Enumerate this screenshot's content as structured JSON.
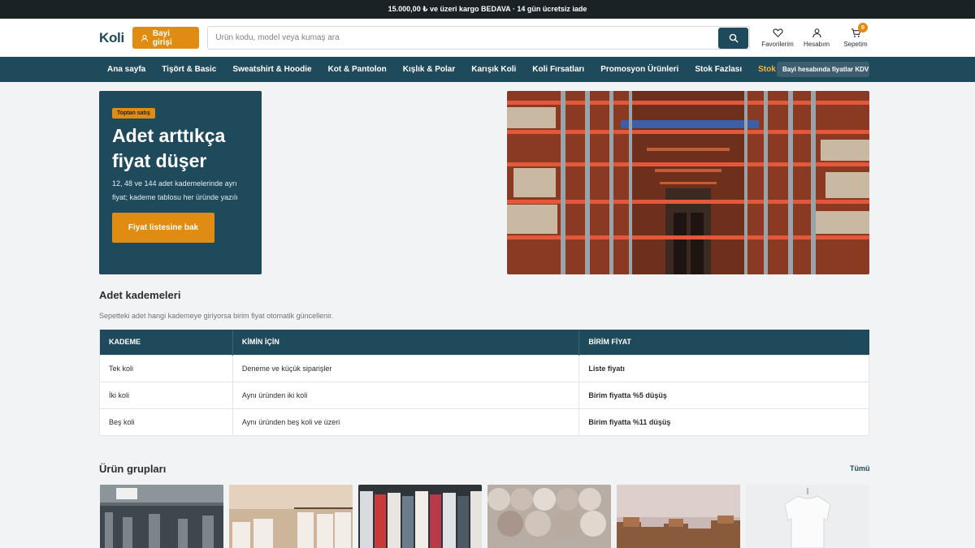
{
  "announcement": "15.000,00 ₺ ve üzeri kargo BEDAVA · 14 gün ücretsiz iade",
  "header": {
    "logo": "Koli",
    "dealer_login": "Bayi girişi",
    "search_placeholder": "Ürün kodu, model veya kumaş ara",
    "favorites": "Favorilerim",
    "account": "Hesabım",
    "cart": "Sepetim",
    "cart_count": "0"
  },
  "nav": {
    "items": [
      "Ana sayfa",
      "Tişört & Basic",
      "Sweatshirt & Hoodie",
      "Kot & Pantolon",
      "Kışlık & Polar",
      "Karışık Koli",
      "Koli Fırsatları",
      "Promosyon Ürünleri",
      "Stok Fazlası",
      "Stok fazlası"
    ],
    "notice": "Bayi hesabında fiyatlar KDV h"
  },
  "hero": {
    "badge": "Toptan satış",
    "title_line1": "Adet arttıkça",
    "title_line2": "fiyat düşer",
    "description": "12, 48 ve 144 adet kademelerinde ayrı fiyat; kademe tablosu her üründe yazılı",
    "button": "Fiyat listesine bak"
  },
  "tiers": {
    "title": "Adet kademeleri",
    "subtitle": "Sepetteki adet hangi kademeye giriyorsa birim fiyat otomatik güncellenir.",
    "headers": [
      "KADEME",
      "KİMİN İÇİN",
      "BİRİM FİYAT"
    ],
    "rows": [
      {
        "tier": "Tek koli",
        "who": "Deneme ve küçük siparişler",
        "price": "Liste fiyatı"
      },
      {
        "tier": "İki koli",
        "who": "Aynı üründen iki koli",
        "price": "Birim fiyatta %5 düşüş"
      },
      {
        "tier": "Beş koli",
        "who": "Aynı üründen beş koli ve üzeri",
        "price": "Birim fiyatta %11 düşüş"
      }
    ]
  },
  "groups": {
    "title": "Ürün grupları",
    "all_link": "Tümü"
  },
  "colors": {
    "primary": "#1f4a5c",
    "accent": "#e08b12",
    "topbar": "#1b2226"
  }
}
